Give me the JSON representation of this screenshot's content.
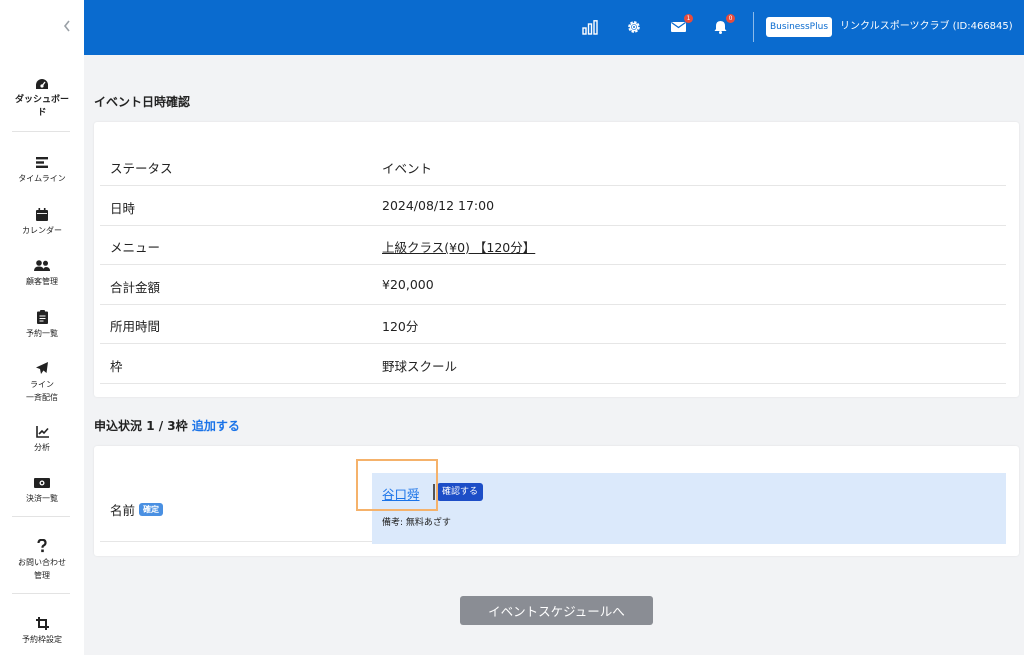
{
  "sidebar": {
    "collapse_icon": "chevron-left-icon",
    "items": [
      {
        "label": "ダッシュボー\nド",
        "icon": "gauge-icon"
      },
      {
        "label": "タイムライン",
        "icon": "timeline-icon"
      },
      {
        "label": "カレンダー",
        "icon": "calendar-icon"
      },
      {
        "label": "顧客管理",
        "icon": "users-icon"
      },
      {
        "label": "予約一覧",
        "icon": "clipboard-icon"
      },
      {
        "label": "ライン\n一斉配信",
        "icon": "paper-plane-icon"
      },
      {
        "label": "分析",
        "icon": "chart-line-icon"
      },
      {
        "label": "決済一覧",
        "icon": "money-bill-icon"
      },
      {
        "label": "お問い合わせ\n管理",
        "icon": "question-icon"
      },
      {
        "label": "予約枠設定",
        "icon": "crop-icon"
      }
    ]
  },
  "header": {
    "mail_badge": "1",
    "bell_badge": "0",
    "plan_badge": "BusinessPlus",
    "company": "リンクルスポーツクラブ (ID:466845)",
    "colors": {
      "bar": "#0a6bcf",
      "badge": "#e74c3c"
    }
  },
  "event": {
    "section_title": "イベント日時確認",
    "rows": [
      {
        "label": "ステータス",
        "value": "イベント"
      },
      {
        "label": "日時",
        "value": "2024/08/12 17:00"
      },
      {
        "label": "メニュー",
        "value": "上級クラス(¥0) 【120分】"
      },
      {
        "label": "合計金額",
        "value": "¥20,000"
      },
      {
        "label": "所用時間",
        "value": "120分"
      },
      {
        "label": "枠",
        "value": "野球スクール"
      }
    ]
  },
  "application": {
    "title_prefix": "申込状況",
    "count": "1 / 3枠",
    "add_label": "追加する",
    "name_label": "名前",
    "status_tag": "確定",
    "applicant_name": "谷口舜",
    "confirm_label": "確認する",
    "note": "備考: 無料あざす"
  },
  "footer": {
    "schedule_button": "イベントスケジュールへ"
  }
}
